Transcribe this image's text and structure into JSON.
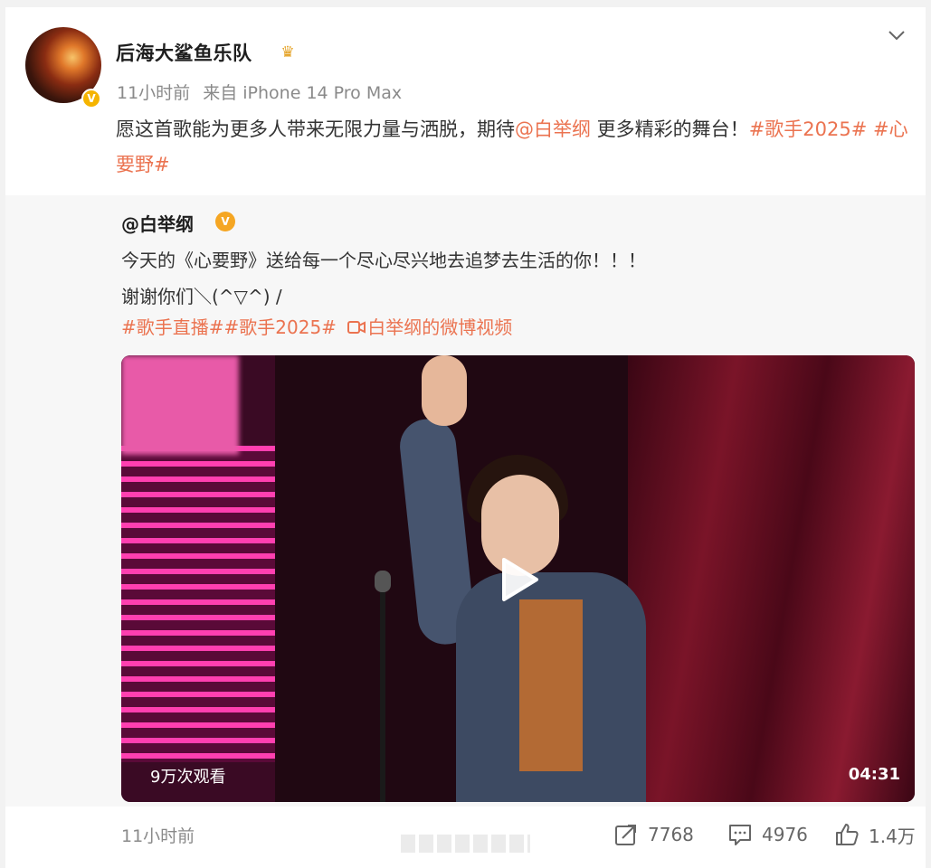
{
  "post": {
    "author": "后海大鲨鱼乐队",
    "time": "11小时前",
    "source": "来自 iPhone 14 Pro Max",
    "text_before": "愿这首歌能为更多人带来无限力量与洒脱，期待",
    "mention": "@白举纲",
    "text_after": " 更多精彩的舞台！",
    "tag1": "#歌手2025#",
    "tag2": "#心要野#",
    "colors": {
      "link": "#eb7350",
      "verified_badge": "#f5b400"
    }
  },
  "repost": {
    "author": "@白举纲",
    "line1": "今天的《心要野》送给每一个尽心尽兴地去追梦去生活的你！！！",
    "line2": "谢谢你们＼(^▽^) /",
    "tags": "#歌手直播##歌手2025#",
    "video_link": "白举纲的微博视频",
    "video": {
      "views": "9万次观看",
      "duration": "04:31"
    }
  },
  "footer": {
    "time": "11小时前",
    "reposts": "7768",
    "comments": "4976",
    "likes": "1.4万"
  },
  "icons": [
    "chevron-down-icon",
    "crown-icon",
    "verified-badge-icon",
    "video-camera-icon",
    "play-icon",
    "repost-icon",
    "comment-icon",
    "like-icon"
  ]
}
